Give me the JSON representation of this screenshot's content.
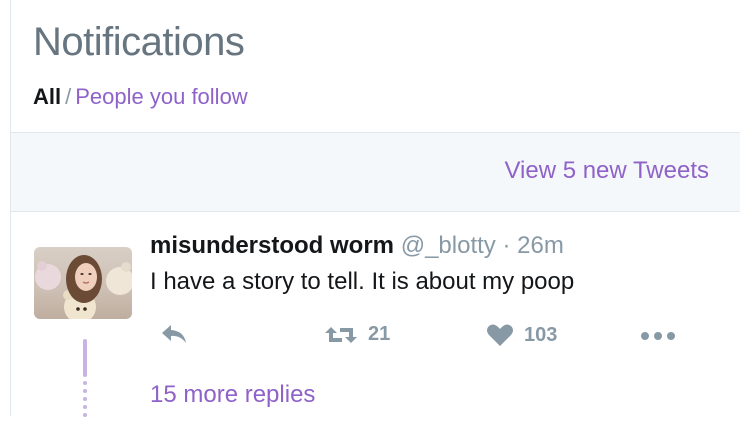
{
  "header": {
    "title": "Notifications",
    "filter_all": "All",
    "filter_separator": "/",
    "filter_follow": "People you follow"
  },
  "new_tweets": {
    "label": "View 5 new Tweets"
  },
  "tweet": {
    "name": "misunderstood worm",
    "handle": "@_blotty",
    "dot": "·",
    "time": "26m",
    "text": "I have a story to tell. It is about my poop",
    "retweet_count": "21",
    "like_count": "103",
    "more_replies": "15 more replies"
  },
  "colors": {
    "accent": "#8e62c8",
    "muted": "#8899a6",
    "thread": "#c7b4e2"
  },
  "icons": [
    "reply-icon",
    "retweet-icon",
    "like-heart-icon",
    "more-dots-icon"
  ]
}
